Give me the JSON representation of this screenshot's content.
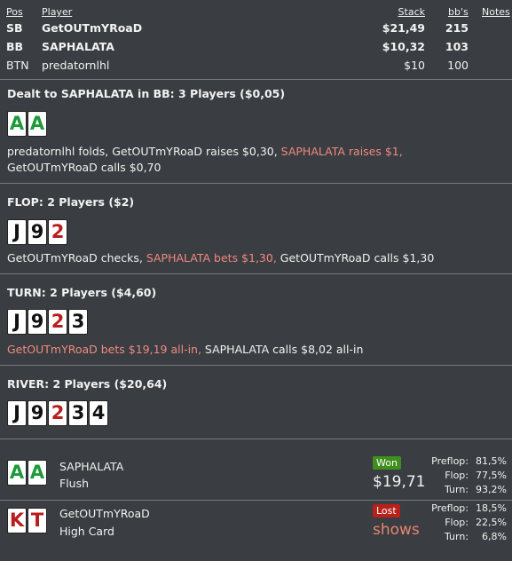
{
  "header": {
    "pos": "Pos",
    "player": "Player",
    "stack": "Stack",
    "bbs": "bb's",
    "notes": "Notes"
  },
  "players": [
    {
      "pos": "SB",
      "name": "GetOUTmYRoaD",
      "stack": "$21,49",
      "bbs": "215",
      "bold": true
    },
    {
      "pos": "BB",
      "name": "SAPHALATA",
      "stack": "$10,32",
      "bbs": "103",
      "bold": true
    },
    {
      "pos": "BTN",
      "name": "predatornlhl",
      "stack": "$10",
      "bbs": "100",
      "bold": false
    }
  ],
  "preflop": {
    "title": "Dealt to SAPHALATA in BB: 3 Players ($0,05)",
    "cards": [
      {
        "rank": "A",
        "color": "#1e9a3a"
      },
      {
        "rank": "A",
        "color": "#1e9a3a"
      }
    ],
    "action_1": "predatornlhl folds, GetOUTmYRoaD raises $0,30, ",
    "action_hl": "SAPHALATA raises $1,",
    "action_2": " GetOUTmYRoaD calls $0,70"
  },
  "flop": {
    "title": "FLOP: 2 Players ($2)",
    "cards": [
      {
        "rank": "J",
        "color": "#111111"
      },
      {
        "rank": "9",
        "color": "#111111"
      },
      {
        "rank": "2",
        "color": "#b81d1d"
      }
    ],
    "action_1": "GetOUTmYRoaD checks, ",
    "action_hl": "SAPHALATA bets $1,30,",
    "action_2": " GetOUTmYRoaD calls $1,30"
  },
  "turn": {
    "title": "TURN: 2 Players ($4,60)",
    "cards": [
      {
        "rank": "J",
        "color": "#111111"
      },
      {
        "rank": "9",
        "color": "#111111"
      },
      {
        "rank": "2",
        "color": "#b81d1d"
      },
      {
        "rank": "3",
        "color": "#111111"
      }
    ],
    "action_hl": "GetOUTmYRoaD bets $19,19 all-in,",
    "action_2": " SAPHALATA calls $8,02 all-in"
  },
  "river": {
    "title": "RIVER: 2 Players ($20,64)",
    "cards": [
      {
        "rank": "J",
        "color": "#111111"
      },
      {
        "rank": "9",
        "color": "#111111"
      },
      {
        "rank": "2",
        "color": "#b81d1d"
      },
      {
        "rank": "3",
        "color": "#111111"
      },
      {
        "rank": "4",
        "color": "#111111"
      }
    ]
  },
  "results": [
    {
      "name": "SAPHALATA",
      "hand": "Flush",
      "cards": [
        {
          "rank": "A",
          "color": "#1e9a3a"
        },
        {
          "rank": "A",
          "color": "#1e9a3a"
        }
      ],
      "badge": "Won",
      "badge_color": "#3f8f1f",
      "amount": "$19,71",
      "amount_color": "#f2f2f2",
      "stats": [
        {
          "label": "Preflop:",
          "value": "81,5%"
        },
        {
          "label": "Flop:",
          "value": "77,5%"
        },
        {
          "label": "Turn:",
          "value": "93,2%"
        }
      ]
    },
    {
      "name": "GetOUTmYRoaD",
      "hand": "High Card",
      "cards": [
        {
          "rank": "K",
          "color": "#b81d1d"
        },
        {
          "rank": "T",
          "color": "#b81d1d"
        }
      ],
      "badge": "Lost",
      "badge_color": "#b8201c",
      "amount": "shows",
      "amount_color": "#e8866f",
      "stats": [
        {
          "label": "Preflop:",
          "value": "18,5%"
        },
        {
          "label": "Flop:",
          "value": "22,5%"
        },
        {
          "label": "Turn:",
          "value": "6,8%"
        }
      ]
    }
  ]
}
